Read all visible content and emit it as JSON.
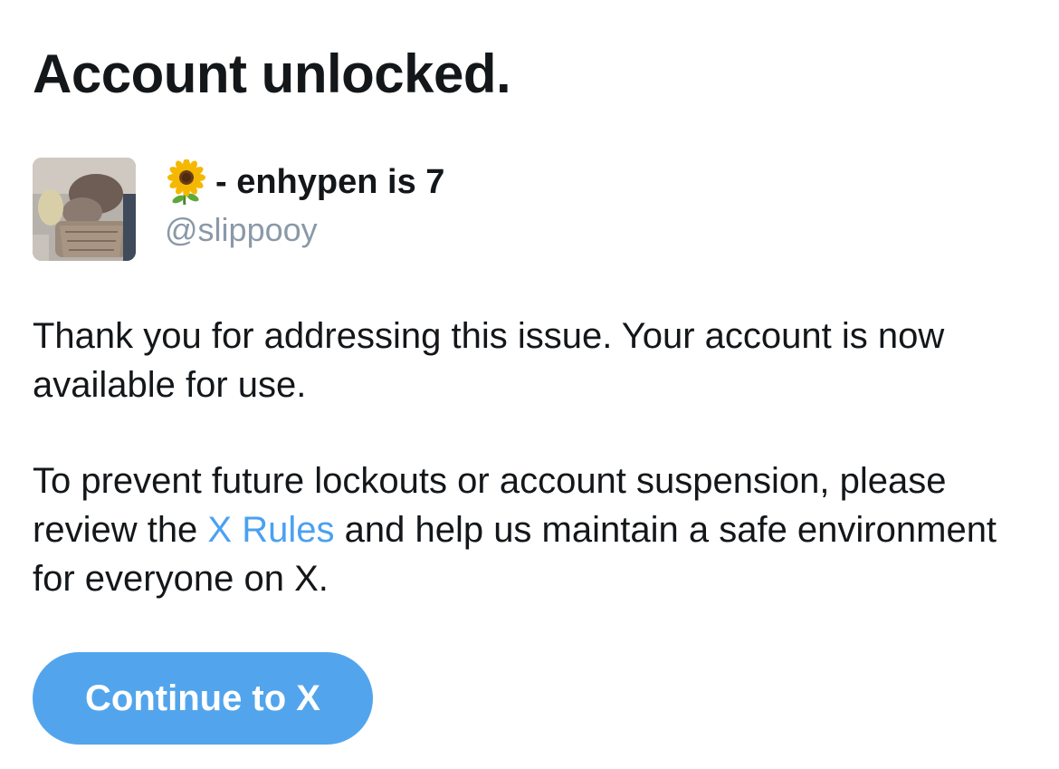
{
  "page": {
    "title": "Account unlocked."
  },
  "account": {
    "display_name": "- enhypen is 7",
    "display_name_emoji_icon": "sunflower-icon",
    "handle": "@slippooy",
    "avatar_icon": "profile-photo"
  },
  "message": {
    "paragraph1": "Thank you for addressing this issue. Your account is now available for use.",
    "paragraph2_before_link": "To prevent future lockouts or account suspension, please review the ",
    "paragraph2_link": "X Rules",
    "paragraph2_after_link": " and help us maintain a safe environment for everyone on X."
  },
  "actions": {
    "continue_label": "Continue to X"
  },
  "colors": {
    "text": "#14171a",
    "handle": "#8a99a8",
    "link": "#4aa1f1",
    "button_bg": "#52a5ec",
    "button_text": "#ffffff"
  }
}
